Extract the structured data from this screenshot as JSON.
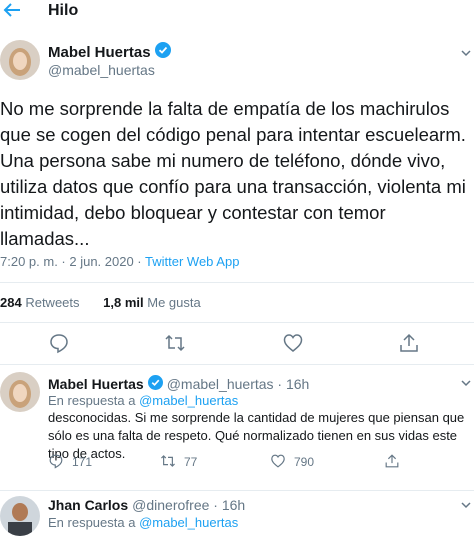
{
  "header": {
    "back_icon": "arrow-left-icon",
    "title": "Hilo"
  },
  "main_tweet": {
    "author_name": "Mabel Huertas",
    "handle": "@mabel_huertas",
    "text": "No  me sorprende la falta de empatía de los machirulos que se cogen del código penal para intentar escuelearm. Una persona sabe mi numero de teléfono, dónde vivo, utiliza datos que confío para una transacción, violenta mi intimidad, debo bloquear y contestar con temor llamadas...",
    "time": "7:20 p. m. · 2 jun. 2020 · ",
    "source": "Twitter Web App",
    "retweets_count": "284",
    "retweets_label": "Retweets",
    "likes_count": "1,8 mil",
    "likes_label": "Me gusta"
  },
  "reply1": {
    "author_name": "Mabel Huertas",
    "handle_time": "@mabel_huertas · 16h",
    "in_reply_prefix": "En respuesta a ",
    "in_reply_handle": "@mabel_huertas",
    "text": "desconocidas. Si me sorprende la cantidad de mujeres que piensan que sólo es una falta de respeto. Qué normalizado tienen en sus vidas este tipo de actos.",
    "replies": "171",
    "retweets": "77",
    "likes": "790"
  },
  "reply2": {
    "author_name": "Jhan Carlos",
    "handle_time": "@dinerofree · 16h",
    "in_reply_prefix": "En respuesta a ",
    "in_reply_handle": "@mabel_huertas"
  },
  "colors": {
    "accent": "#1da1f2",
    "muted": "#657786",
    "text": "#14171a",
    "divider": "#e6ecf0"
  }
}
